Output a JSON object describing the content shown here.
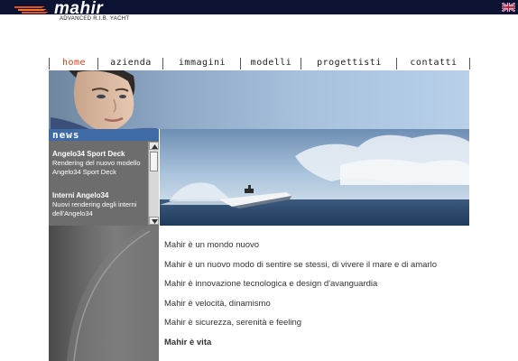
{
  "brand": {
    "name": "mahir",
    "tagline": "ADVANCED R.I.B. YACHT"
  },
  "language_flag": "uk-flag-icon",
  "nav": [
    {
      "label": "home",
      "active": true
    },
    {
      "label": "azienda",
      "active": false
    },
    {
      "label": "immagini",
      "active": false
    },
    {
      "label": "modelli",
      "active": false
    },
    {
      "label": "progettisti",
      "active": false
    },
    {
      "label": "contatti",
      "active": false
    }
  ],
  "news": {
    "heading": "news",
    "items": [
      {
        "title": "Angelo34 Sport Deck",
        "text1": "Rendering del nuovo modello",
        "text2": "Angelo34 Sport Deck"
      },
      {
        "title": "Interni Angelo34",
        "text1": "Nuovi rendering degli interni",
        "text2": "dell'Angelo34"
      }
    ]
  },
  "content": {
    "lines": [
      "Mahir è un mondo nuovo",
      "Mahir è un nuovo modo di sentire se stessi, di vivere il mare e di amarlo",
      "Mahir è innovazione tecnologica e design d'avanguardia",
      "Mahir è velocità, dinamismo",
      "Mahir è sicurezza, serenità e feeling",
      "Mahir è vita"
    ]
  },
  "colors": {
    "topbar": "#0b1232",
    "accent": "#d43a1a",
    "news_header": "#3e6aa6"
  }
}
